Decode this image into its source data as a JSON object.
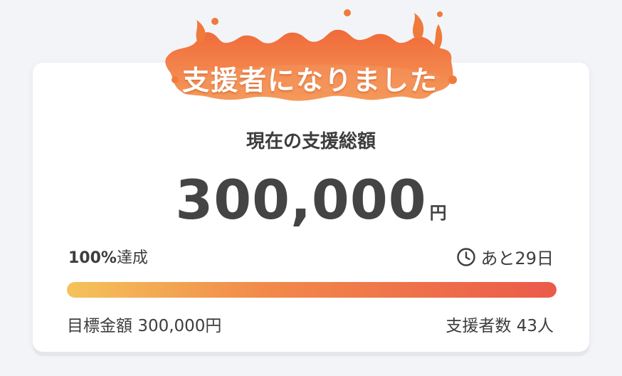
{
  "badge": {
    "text": "支援者になりました"
  },
  "summary": {
    "label": "現在の支援総額",
    "amount": "300,000",
    "unit": "円"
  },
  "progress": {
    "percent_label": "100%",
    "achieve_label": "達成",
    "percent_value": 100,
    "remaining_label": "あと29日",
    "remaining_icon": "clock-icon"
  },
  "footer": {
    "goal_label": "目標金額",
    "goal_value": "300,000円",
    "supporters_label": "支援者数",
    "supporters_value": "43人"
  },
  "colors": {
    "badge_orange": "#f07a3c",
    "progress_start": "#f4c35a",
    "progress_end": "#eb5a4a",
    "text": "#3d3d3d",
    "background": "#f3f4f8"
  }
}
